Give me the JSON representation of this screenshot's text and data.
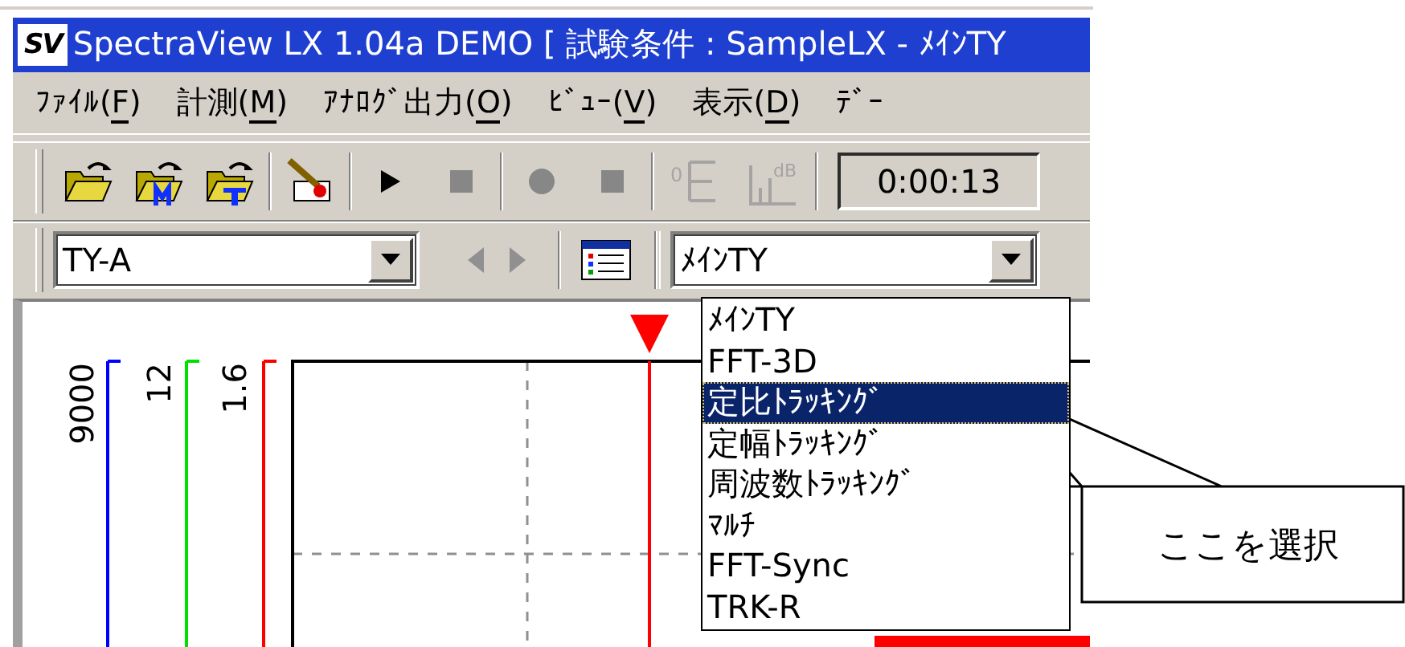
{
  "window": {
    "title": "SpectraView LX 1.04a DEMO [ 試験条件 : SampleLX - ﾒｲﾝTY",
    "logo": "SV"
  },
  "menu": [
    {
      "label": "ﾌｧｲﾙ(F)",
      "mnemonic": true
    },
    {
      "label": "計測(M)",
      "mnemonic": true
    },
    {
      "label": "ｱﾅﾛｸﾞ出力(O)",
      "mnemonic": true
    },
    {
      "label": "ﾋﾞｭｰ(V)",
      "mnemonic": true
    },
    {
      "label": "表示(D)",
      "mnemonic": true
    },
    {
      "label": "ﾃﾞｰ"
    }
  ],
  "toolbar": {
    "groups": [
      [
        {
          "kind": "folder-open",
          "disabled": false
        },
        {
          "kind": "folder-m",
          "disabled": false
        },
        {
          "kind": "folder-down",
          "disabled": false
        }
      ],
      [
        {
          "kind": "pen-chart",
          "disabled": false
        }
      ],
      [
        {
          "kind": "play",
          "disabled": false
        },
        {
          "kind": "stop",
          "disabled": true
        }
      ],
      [
        {
          "kind": "record",
          "disabled": true
        },
        {
          "kind": "stop",
          "disabled": true
        }
      ],
      [
        {
          "kind": "zero-scale",
          "label": "0",
          "disabled": true
        },
        {
          "kind": "db-scale",
          "label": "dB",
          "disabled": true
        }
      ]
    ],
    "time": "0:00:13"
  },
  "selector": {
    "value": "TY-A",
    "prev_disabled": true,
    "next_disabled": true
  },
  "view_combo": {
    "value": "ﾒｲﾝTY"
  },
  "dropdown": [
    {
      "label": "ﾒｲﾝTY",
      "selected": false
    },
    {
      "label": "FFT-3D",
      "selected": false
    },
    {
      "label": "定比ﾄﾗｯｷﾝｸﾞ",
      "selected": true
    },
    {
      "label": "定幅ﾄﾗｯｷﾝｸﾞ",
      "selected": false
    },
    {
      "label": "周波数ﾄﾗｯｷﾝｸﾞ",
      "selected": false
    },
    {
      "label": "ﾏﾙﾁ",
      "selected": false
    },
    {
      "label": "FFT-Sync",
      "selected": false
    },
    {
      "label": "TRK-R",
      "selected": false
    }
  ],
  "axes": [
    {
      "label": "9000",
      "color": "#0000ff"
    },
    {
      "label": "12",
      "color": "#00e000"
    },
    {
      "label": "1.6",
      "color": "#ff0000"
    }
  ],
  "callout": "ここを選択"
}
